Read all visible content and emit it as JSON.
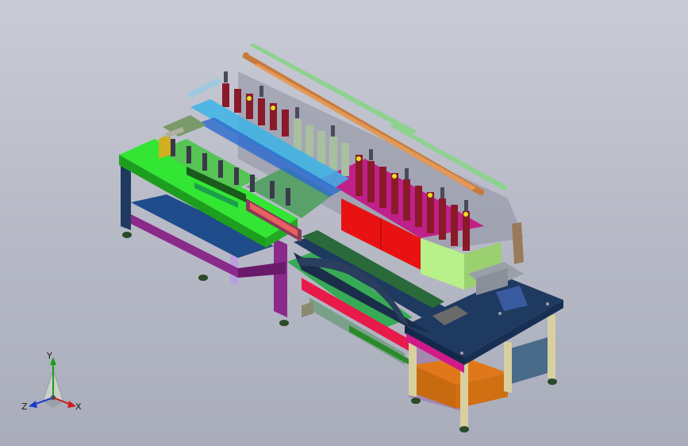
{
  "viewport": {
    "background_top": "#c9cbd6",
    "background_bottom": "#a9acba"
  },
  "colors": {
    "frame_green": "#33e633",
    "leg_purple": "#8a2a8a",
    "top_navy": "#1f3a60",
    "panel_red": "#e81212",
    "panel_magenta": "#c0208a",
    "rail_copper": "#c87a3a",
    "rail_green": "#8fd18f",
    "base_orange": "#e0781a",
    "light_green": "#b8f08a",
    "cyan": "#3cb4e6"
  },
  "triad": {
    "x_label": "X",
    "y_label": "Y",
    "z_label": "Z",
    "icon": "axis-triad-icon"
  }
}
